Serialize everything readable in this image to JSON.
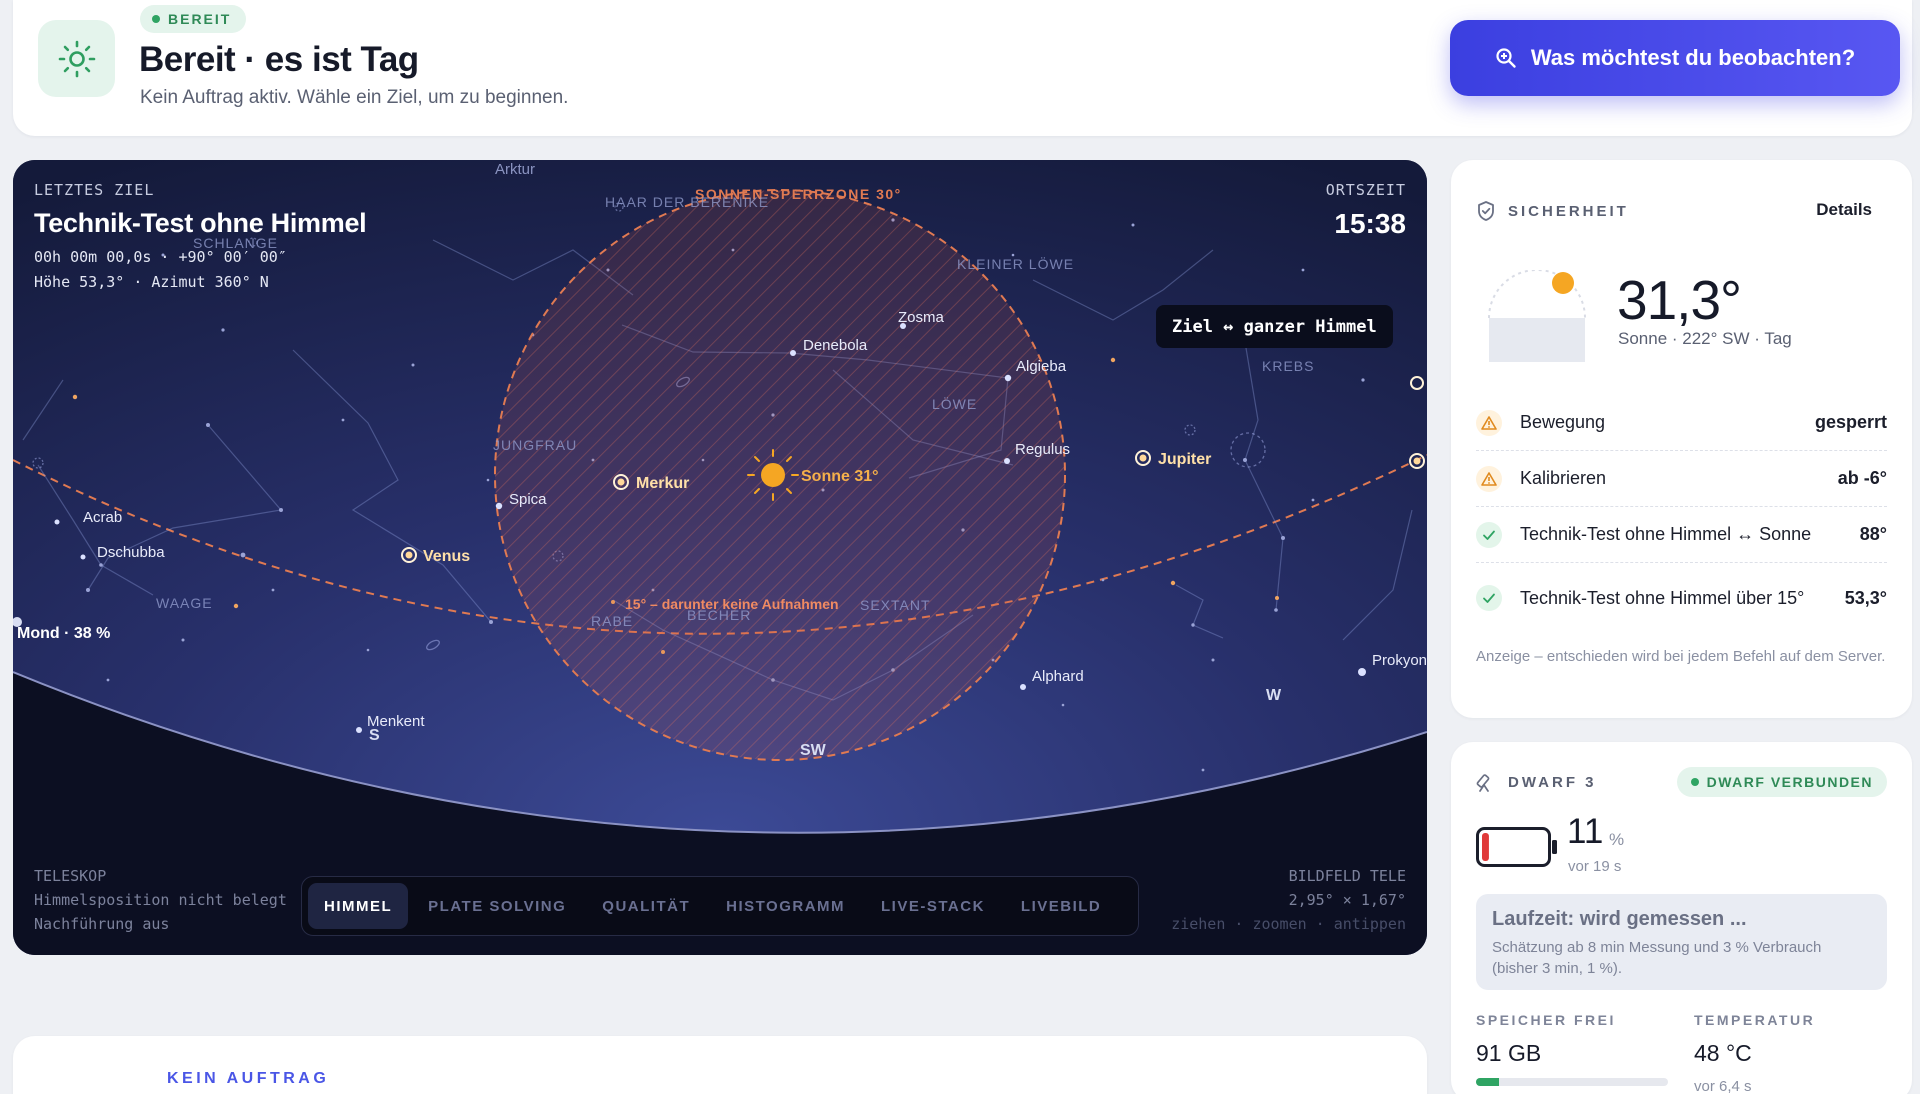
{
  "header": {
    "status": "BEREIT",
    "title": "Bereit · es ist Tag",
    "subtitle": "Kein Auftrag aktiv. Wähle ein Ziel, um zu beginnen.",
    "cta": "Was möchtest du beobachten?"
  },
  "sky": {
    "target_label": "LETZTES ZIEL",
    "target_name": "Technik-Test ohne Himmel",
    "target_coord": "00h 00m 00,0s · +90° 00′ 00″",
    "target_alt": "Höhe 53,3° · Azimut 360° N",
    "time_label": "ORTSZEIT",
    "time": "15:38",
    "toggle": "Ziel ↔ ganzer Himmel",
    "tele_label": "TELESKOP",
    "tele_line1": "Himmelsposition nicht belegt",
    "tele_line2": "Nachführung aus",
    "fov_label": "BILDFELD TELE",
    "fov_value": "2,95° × 1,67°",
    "hint": "ziehen · zoomen · antippen",
    "tabs": [
      "HIMMEL",
      "PLATE SOLVING",
      "QUALITÄT",
      "HISTOGRAMM",
      "LIVE-STACK",
      "LIVEBILD"
    ],
    "map": {
      "sun_zone": "SONNEN-SPERRZONE 30°",
      "horizon_note": "15° – darunter keine Aufnahmen",
      "sun": "Sonne 31°",
      "moon": "Mond · 38 %",
      "planets": [
        "Merkur",
        "Venus",
        "Jupiter"
      ],
      "stars": [
        "Arktur",
        "Denebola",
        "Zosma",
        "Algieba",
        "Regulus",
        "Spica",
        "Acrab",
        "Dschubba",
        "Alphard",
        "Menkent",
        "Prokyon"
      ],
      "constellations": [
        "HAAR DER BERENIKE",
        "SCHLANGE",
        "KLEINER LÖWE",
        "KREBS",
        "LÖWE",
        "JUNGFRAU",
        "WAAGE",
        "RABE",
        "BECHER",
        "SEXTANT"
      ],
      "compass": [
        "SW",
        "W",
        "S"
      ]
    }
  },
  "security": {
    "title": "SICHERHEIT",
    "details": "Details",
    "sun_alt": "31,3°",
    "sun_info": "Sonne · 222° SW · Tag",
    "rows": [
      {
        "label": "Bewegung",
        "value": "gesperrt",
        "state": "warn"
      },
      {
        "label": "Kalibrieren",
        "value": "ab -6°",
        "state": "warn"
      },
      {
        "label": "Technik-Test ohne Himmel ↔ Sonne",
        "value": "88°",
        "state": "ok"
      },
      {
        "label": "Technik-Test ohne Himmel über 15°",
        "value": "53,3°",
        "state": "ok"
      }
    ],
    "note": "Anzeige – entschieden wird bei jedem Befehl auf dem Server."
  },
  "device": {
    "title": "DWARF 3",
    "status": "DWARF VERBUNDEN",
    "battery": "11",
    "battery_unit": "%",
    "battery_level": 0.11,
    "battery_age": "vor 19 s",
    "runtime_title": "Laufzeit: wird gemessen ...",
    "runtime_desc": "Schätzung ab 8 min Messung und 3 % Verbrauch (bisher 3 min, 1 %).",
    "memory_label": "SPEICHER FREI",
    "memory_value": "91 GB",
    "memory_fraction": 0.12,
    "temp_label": "TEMPERATUR",
    "temp_value": "48 °C",
    "temp_age": "vor 6,4 s"
  },
  "bottom": {
    "label": "KEIN AUFTRAG"
  },
  "colors": {
    "accent": "#4a47ea",
    "ok": "#2fa463",
    "warn": "#e8a23a",
    "sun": "#f5a623",
    "danger": "#e2573e"
  }
}
